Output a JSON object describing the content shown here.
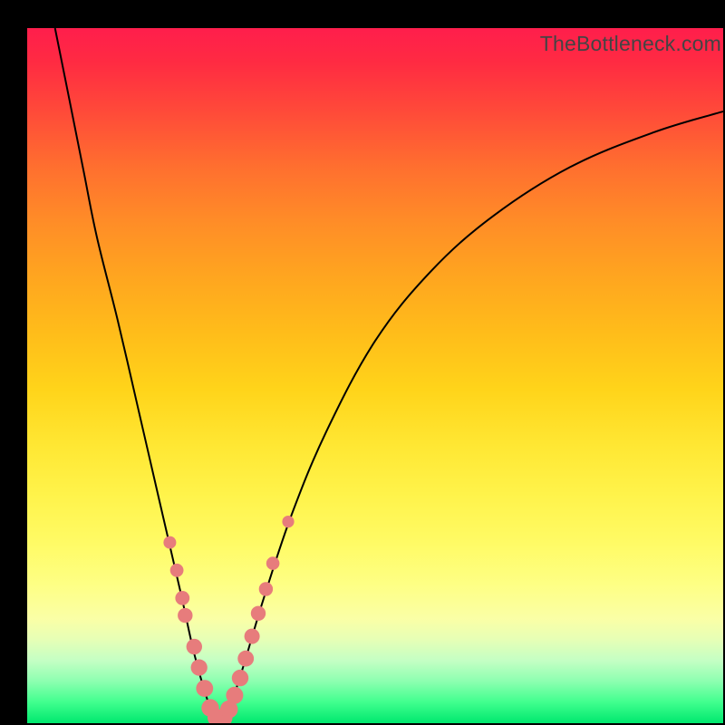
{
  "brand": "TheBottleneck.com",
  "chart_data": {
    "type": "line",
    "title": "",
    "xlabel": "",
    "ylabel": "",
    "xlim": [
      0,
      100
    ],
    "ylim": [
      0,
      100
    ],
    "grid": false,
    "legend": false,
    "background": "rainbow-gradient",
    "series": [
      {
        "name": "bottleneck-curve",
        "description": "V-shaped black bottleneck curve; minimum ≈ x 27, y 0",
        "points": [
          [
            4.0,
            100.0
          ],
          [
            6.0,
            90.0
          ],
          [
            8.0,
            80.0
          ],
          [
            10.0,
            70.0
          ],
          [
            13.0,
            58.0
          ],
          [
            16.0,
            45.0
          ],
          [
            19.0,
            32.0
          ],
          [
            22.0,
            19.0
          ],
          [
            24.0,
            10.0
          ],
          [
            26.0,
            3.0
          ],
          [
            27.0,
            0.5
          ],
          [
            28.0,
            0.5
          ],
          [
            29.0,
            2.0
          ],
          [
            31.0,
            8.0
          ],
          [
            34.0,
            18.0
          ],
          [
            38.0,
            30.0
          ],
          [
            43.0,
            42.0
          ],
          [
            50.0,
            55.0
          ],
          [
            58.0,
            65.0
          ],
          [
            67.0,
            73.0
          ],
          [
            78.0,
            80.0
          ],
          [
            90.0,
            85.0
          ],
          [
            100.0,
            88.0
          ]
        ]
      }
    ],
    "markers": {
      "name": "highlighted-points",
      "color": "#e77c7c",
      "radius_px": [
        5,
        10
      ],
      "points": [
        [
          20.5,
          26.0
        ],
        [
          21.5,
          22.0
        ],
        [
          22.3,
          18.0
        ],
        [
          22.7,
          15.5
        ],
        [
          24.0,
          11.0
        ],
        [
          24.7,
          8.0
        ],
        [
          25.5,
          5.0
        ],
        [
          26.3,
          2.2
        ],
        [
          27.2,
          0.8
        ],
        [
          28.2,
          0.8
        ],
        [
          29.0,
          2.0
        ],
        [
          29.8,
          4.0
        ],
        [
          30.6,
          6.5
        ],
        [
          31.4,
          9.3
        ],
        [
          32.3,
          12.5
        ],
        [
          33.2,
          15.8
        ],
        [
          34.3,
          19.3
        ],
        [
          35.3,
          23.0
        ],
        [
          37.5,
          29.0
        ]
      ]
    }
  }
}
